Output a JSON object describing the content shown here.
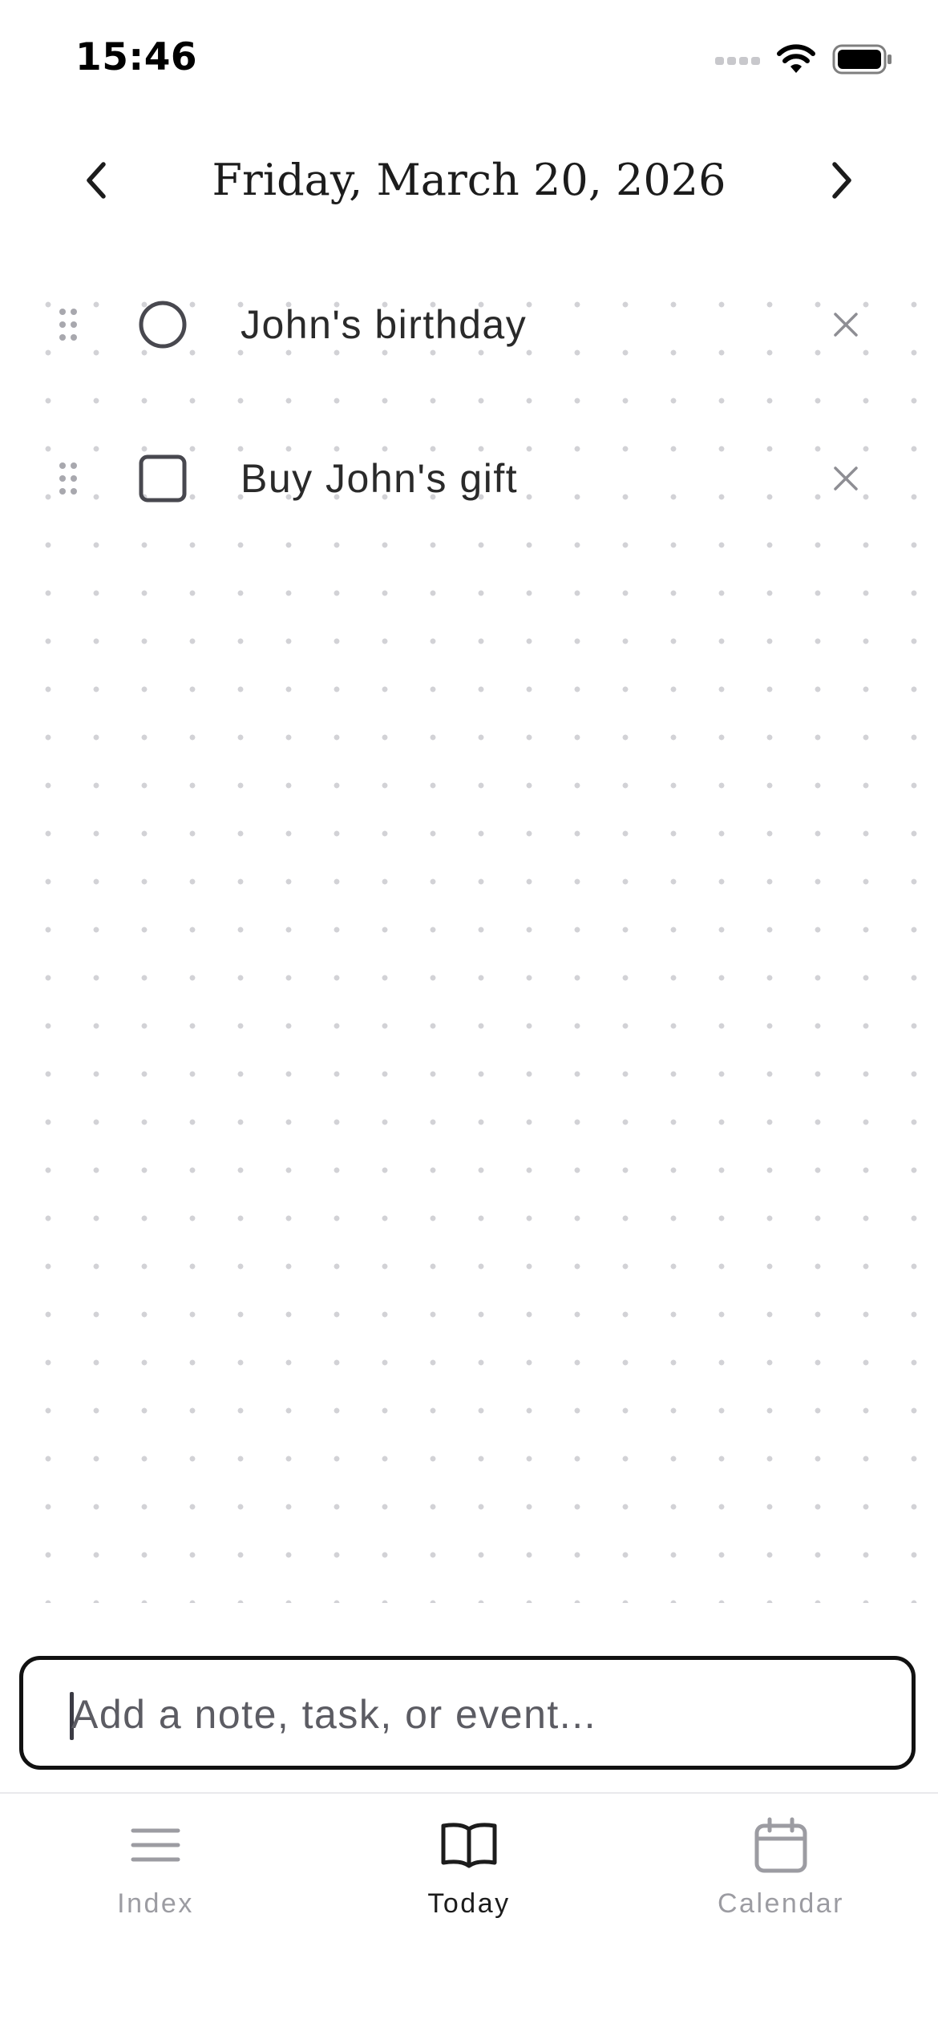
{
  "status_bar": {
    "time": "15:46",
    "icons": [
      "cellular-signal-icon",
      "wifi-icon",
      "battery-icon"
    ]
  },
  "header": {
    "date_title": "Friday, March 20, 2026",
    "prev_icon": "chevron-left-icon",
    "next_icon": "chevron-right-icon"
  },
  "entries": [
    {
      "type": "event",
      "marker_icon": "event-circle-icon",
      "text": "John's birthday",
      "delete_icon": "close-icon"
    },
    {
      "type": "task",
      "marker_icon": "task-checkbox-icon",
      "text": "Buy John's gift",
      "delete_icon": "close-icon"
    }
  ],
  "composer": {
    "value": "",
    "placeholder": "Add a note, task, or event..."
  },
  "tabs": [
    {
      "label": "Index",
      "icon": "menu-lines-icon",
      "active": false
    },
    {
      "label": "Today",
      "icon": "open-book-icon",
      "active": true
    },
    {
      "label": "Calendar",
      "icon": "calendar-icon",
      "active": false
    }
  ],
  "colors": {
    "text_primary": "#1c1c1c",
    "text_muted": "#9c9ca2",
    "icon_dark": "#48484f",
    "grid_dot": "#d2d2d6",
    "composer_border": "#111111"
  }
}
